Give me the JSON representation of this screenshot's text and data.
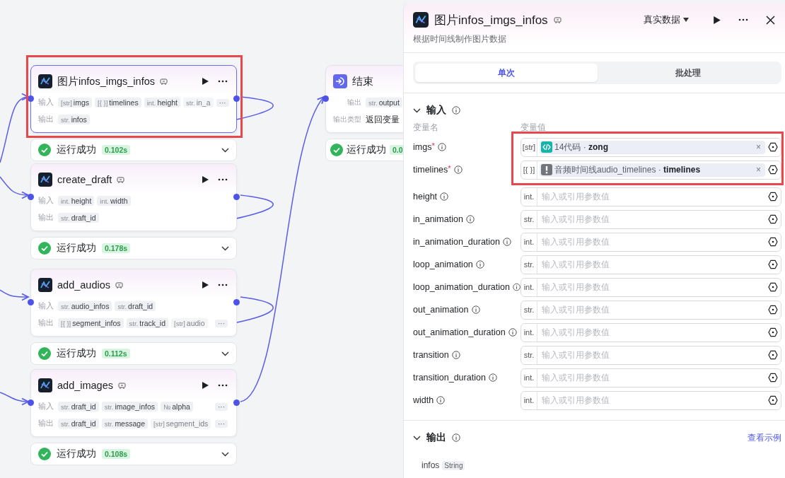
{
  "canvas": {
    "nodes": [
      {
        "title": "图片infos_imgs_infos",
        "selected": true,
        "highlighted": true,
        "rows": [
          {
            "label": "输入",
            "tags": [
              {
                "type": "[str]",
                "name": "imgs",
                "faded": false
              },
              {
                "type": "[{ }]",
                "name": "timelines",
                "faded": false
              },
              {
                "type": "int.",
                "name": "height",
                "faded": false
              },
              {
                "type": "str.",
                "name": "in_a",
                "faded": true
              }
            ],
            "more": "···"
          },
          {
            "label": "输出",
            "tags": [
              {
                "type": "str.",
                "name": "infos",
                "faded": false
              }
            ]
          }
        ],
        "status": {
          "text": "运行成功",
          "time": "0.102s"
        }
      },
      {
        "title": "create_draft",
        "selected": false,
        "highlighted": false,
        "rows": [
          {
            "label": "输入",
            "tags": [
              {
                "type": "int.",
                "name": "height",
                "faded": false
              },
              {
                "type": "int.",
                "name": "width",
                "faded": false
              }
            ]
          },
          {
            "label": "输出",
            "tags": [
              {
                "type": "str.",
                "name": "draft_id",
                "faded": false
              }
            ]
          }
        ],
        "status": {
          "text": "运行成功",
          "time": "0.178s"
        }
      },
      {
        "title": "add_audios",
        "selected": false,
        "highlighted": false,
        "rows": [
          {
            "label": "输入",
            "tags": [
              {
                "type": "str.",
                "name": "audio_infos",
                "faded": false
              },
              {
                "type": "str.",
                "name": "draft_id",
                "faded": false
              }
            ]
          },
          {
            "label": "输出",
            "tags": [
              {
                "type": "[{ }]",
                "name": "segment_infos",
                "faded": false
              },
              {
                "type": "str.",
                "name": "track_id",
                "faded": false
              },
              {
                "type": "[str]",
                "name": "audio",
                "faded": true
              }
            ],
            "more": "···"
          }
        ],
        "status": {
          "text": "运行成功",
          "time": "0.112s"
        }
      },
      {
        "title": "add_images",
        "selected": false,
        "highlighted": false,
        "rows": [
          {
            "label": "输入",
            "tags": [
              {
                "type": "str.",
                "name": "draft_id",
                "faded": false
              },
              {
                "type": "str.",
                "name": "image_infos",
                "faded": false
              },
              {
                "type": "№",
                "name": "alpha",
                "faded": false
              }
            ],
            "more": "···"
          },
          {
            "label": "输出",
            "tags": [
              {
                "type": "str.",
                "name": "draft_id",
                "faded": false
              },
              {
                "type": "str.",
                "name": "message",
                "faded": false
              },
              {
                "type": "[str]",
                "name": "segment_ids",
                "faded": true
              }
            ],
            "more": "···"
          }
        ],
        "status": {
          "text": "运行成功",
          "time": "0.108s"
        }
      }
    ],
    "end_node": {
      "title": "结束",
      "rows": [
        {
          "kind": "tags",
          "label": "输出",
          "tags": [
            {
              "type": "str.",
              "name": "output",
              "faded": false
            }
          ]
        },
        {
          "kind": "text",
          "label": "输出类型",
          "value": "返回变量"
        }
      ],
      "status": {
        "text": "运行成功",
        "time": "0.0"
      }
    }
  },
  "panel": {
    "title": "图片infos_imgs_infos",
    "data_source": "真实数据",
    "description": "根据时间线制作图片数据",
    "tabs": [
      {
        "label": "单次",
        "selected": true
      },
      {
        "label": "批处理",
        "selected": false
      }
    ],
    "input_section": {
      "title": "输入",
      "expanded": true,
      "name_header": "变量名",
      "value_header": "变量值",
      "params": [
        {
          "name": "imgs",
          "required_mark": "*",
          "type": "[str]",
          "highlighted": true,
          "ref": {
            "kind": "code",
            "text": "14代码 · **zong**",
            "clear": "×"
          }
        },
        {
          "name": "timelines",
          "required_mark": "*",
          "type": "[{ }]",
          "highlighted": true,
          "ref": {
            "kind": "warning",
            "text": "音频时间线audio_timelines · **timelines**",
            "clear": "×"
          }
        },
        {
          "name": "height",
          "type": "int.",
          "highlighted": false,
          "placeholder": "输入或引用参数值"
        },
        {
          "name": "in_animation",
          "type": "str.",
          "highlighted": false,
          "placeholder": "输入或引用参数值"
        },
        {
          "name": "in_animation_duration",
          "type": "int.",
          "highlighted": false,
          "placeholder": "输入或引用参数值"
        },
        {
          "name": "loop_animation",
          "type": "str.",
          "highlighted": false,
          "placeholder": "输入或引用参数值"
        },
        {
          "name": "loop_animation_duration",
          "type": "int.",
          "highlighted": false,
          "placeholder": "输入或引用参数值"
        },
        {
          "name": "out_animation",
          "type": "str.",
          "highlighted": false,
          "placeholder": "输入或引用参数值"
        },
        {
          "name": "out_animation_duration",
          "type": "int.",
          "highlighted": false,
          "placeholder": "输入或引用参数值"
        },
        {
          "name": "transition",
          "type": "str.",
          "highlighted": false,
          "placeholder": "输入或引用参数值"
        },
        {
          "name": "transition_duration",
          "type": "int.",
          "highlighted": false,
          "placeholder": "输入或引用参数值"
        },
        {
          "name": "width",
          "type": "int.",
          "highlighted": false,
          "placeholder": "输入或引用参数值"
        }
      ]
    },
    "output_section": {
      "title": "输出",
      "expanded": true,
      "link": "查看示例",
      "outputs": [
        {
          "name": "infos",
          "type": "String"
        }
      ]
    }
  }
}
